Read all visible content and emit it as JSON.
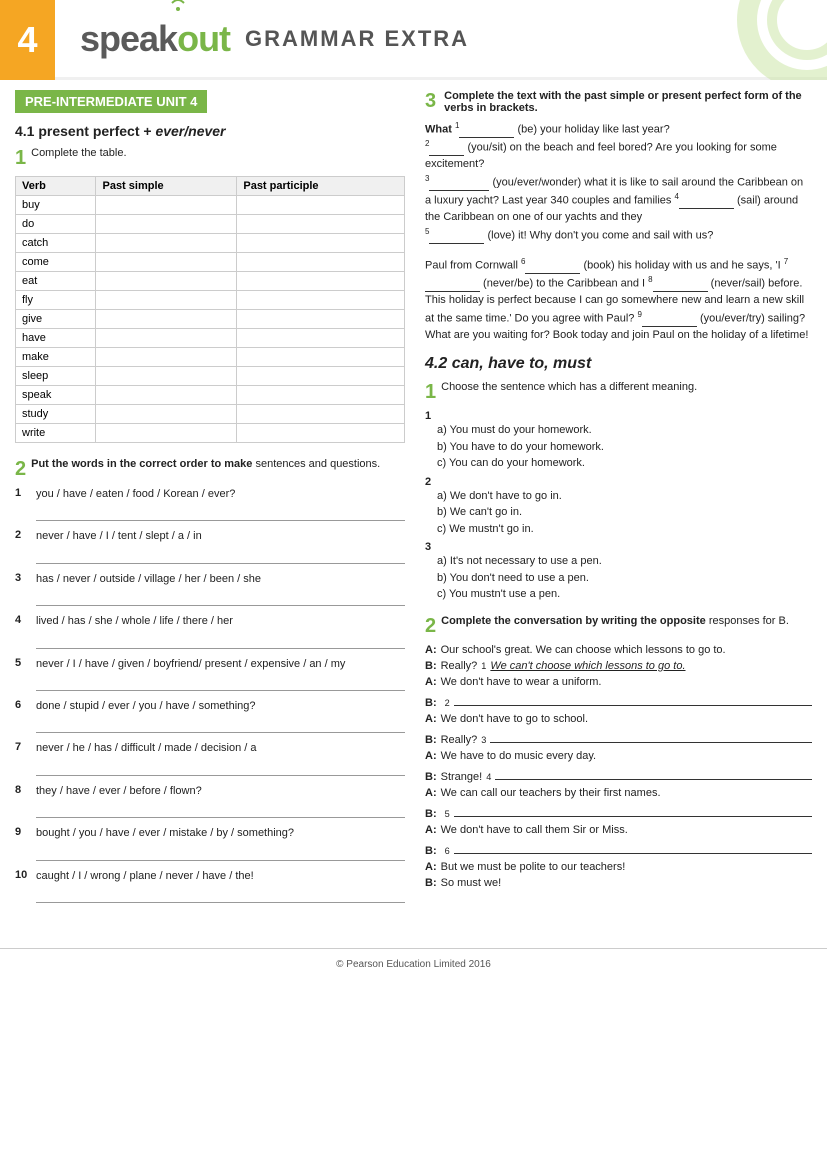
{
  "header": {
    "unit_number": "4",
    "logo_speak": "speak",
    "logo_out": "out",
    "grammar_extra": "GRAMMAR EXTRA"
  },
  "badge": {
    "text": "PRE-INTERMEDIATE UNIT 4"
  },
  "section41": {
    "title": "4.1 present perfect + ",
    "title_italic": "ever/never",
    "ex1_instruction": "Complete the table.",
    "table_headers": [
      "Verb",
      "Past simple",
      "Past participle"
    ],
    "table_verbs": [
      "buy",
      "do",
      "catch",
      "come",
      "eat",
      "fly",
      "give",
      "have",
      "make",
      "sleep",
      "speak",
      "study",
      "write"
    ]
  },
  "section41_ex2": {
    "instruction_bold": "Put the words in the correct order to make",
    "instruction_rest": " sentences and questions.",
    "items": [
      {
        "num": "1",
        "text": "you / have / eaten / food / Korean / ever?"
      },
      {
        "num": "2",
        "text": "never / have / I / tent / slept / a / in"
      },
      {
        "num": "3",
        "text": "has / never / outside / village / her / been / she"
      },
      {
        "num": "4",
        "text": "lived / has / she / whole / life / there / her"
      },
      {
        "num": "5",
        "text": "never / I / have / given / boyfriend/ present / expensive / an / my"
      },
      {
        "num": "6",
        "text": "done / stupid / ever / you / have / something?"
      },
      {
        "num": "7",
        "text": "never / he / has / difficult / made / decision / a"
      },
      {
        "num": "8",
        "text": "they / have / ever / before / flown?"
      },
      {
        "num": "9",
        "text": "bought / you / have / ever / mistake / by / something?"
      },
      {
        "num": "10",
        "text": "caught / I / wrong / plane / never / have / the!"
      }
    ]
  },
  "section3_right": {
    "instruction": "Complete the text with the past simple or present perfect form of the verbs in brackets.",
    "paragraph1": {
      "text": " (be) your holiday like last year?",
      "text2": " (you/sit) on the beach and feel bored? Are you looking for some excitement?",
      "text3": " (you/ever/wonder) what it is like to sail around the Caribbean on a luxury yacht? Last year 340 couples and families",
      "text4": " (sail) around the Caribbean on one of our yachts and they",
      "text5": " (love) it! Why don't you come and sail with us?"
    },
    "paragraph2": {
      "text6": " (book) his holiday with us and he says, 'I",
      "text7": " (never/be) to the Caribbean and I",
      "text8": " (never/sail) before. This holiday is perfect because I can go somewhere new and learn a new skill at the same time.' Do you agree with Paul?",
      "text9": " (you/ever/try) sailing? What are you waiting for? Book today and join Paul on the holiday of a lifetime!"
    },
    "what_label": "What"
  },
  "section42": {
    "title": "4.2 can, have to, must",
    "ex1_instruction": "Choose the sentence which has a different meaning.",
    "choose_items": [
      {
        "num": "1",
        "a": "a) You must do your homework.",
        "b": "b) You have to do your homework.",
        "c": "c) You can do your homework."
      },
      {
        "num": "2",
        "a": "a) We don't have to go in.",
        "b": "b) We can't go in.",
        "c": "c) We mustn't go in."
      },
      {
        "num": "3",
        "a": "a) It's not necessary to use a pen.",
        "b": "b) You don't need to use a pen.",
        "c": "c) You mustn't use a pen."
      }
    ],
    "ex2_instruction_bold": "Complete the conversation by writing the opposite",
    "ex2_instruction_rest": " responses for B.",
    "convo": [
      {
        "speaker": "A",
        "text": "Our school's great. We can choose which lessons to go to."
      },
      {
        "speaker": "B",
        "text": "Really? ",
        "blank_superscript": "1",
        "underline_text": "We can't choose which lessons to go to.",
        "after": ""
      },
      {
        "speaker": "A",
        "text": "We don't have to wear a uniform."
      },
      {
        "speaker": "B",
        "text": "",
        "blank_superscript": "2",
        "blank": true
      },
      {
        "speaker": "A",
        "text": "We don't have to go to school."
      },
      {
        "speaker": "B",
        "text": "Really? ",
        "blank_superscript": "3",
        "blank": true
      },
      {
        "speaker": "A",
        "text": "We have to do music every day."
      },
      {
        "speaker": "B",
        "text": "Strange! ",
        "blank_superscript": "4",
        "blank": true
      },
      {
        "speaker": "A",
        "text": "We can call our teachers by their first names."
      },
      {
        "speaker": "B",
        "text": "",
        "blank_superscript": "5",
        "blank": true
      },
      {
        "speaker": "A",
        "text": "We don't have to call them Sir or Miss."
      },
      {
        "speaker": "B",
        "text": "",
        "blank_superscript": "6",
        "blank": true
      },
      {
        "speaker": "A",
        "text": "But we must be polite to our teachers!"
      },
      {
        "speaker": "B",
        "text": "So must we!"
      }
    ]
  },
  "footer": {
    "text": "© Pearson Education Limited 2016"
  }
}
